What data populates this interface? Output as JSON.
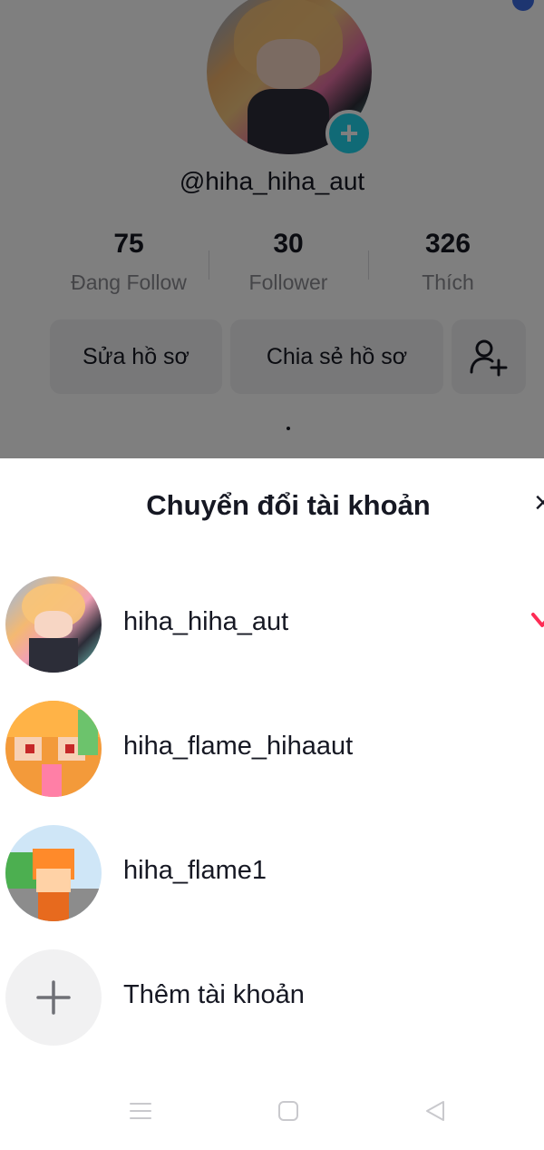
{
  "profile": {
    "username": "@hiha_hiha_aut",
    "stats": [
      {
        "value": "75",
        "label": "Đang Follow"
      },
      {
        "value": "30",
        "label": "Follower"
      },
      {
        "value": "326",
        "label": "Thích"
      }
    ],
    "edit_button": "Sửa hồ sơ",
    "share_button": "Chia sẻ hồ sơ",
    "add_friend_icon": "add-person-icon",
    "avatar_plus_icon": "plus-icon"
  },
  "switch_sheet": {
    "title": "Chuyển đổi tài khoản",
    "close_icon": "close-icon",
    "accounts": [
      {
        "name": "hiha_hiha_aut",
        "selected": true
      },
      {
        "name": "hiha_flame_hihaaut",
        "selected": false
      },
      {
        "name": "hiha_flame1",
        "selected": false
      }
    ],
    "add_account_label": "Thêm tài khoản",
    "check_color": "#fe2c55"
  },
  "navbar": {
    "icons": [
      "menu-icon",
      "home-square-icon",
      "back-triangle-icon"
    ]
  }
}
